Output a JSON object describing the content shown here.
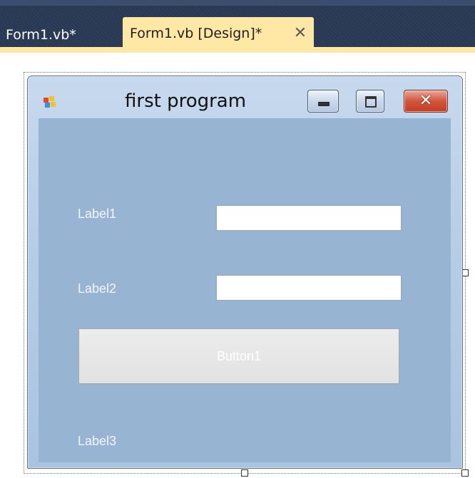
{
  "tabs": {
    "inactive_label": "Form1.vb*",
    "active_label": "Form1.vb [Design]*",
    "close_glyph": "✕"
  },
  "form": {
    "title": "first program",
    "title_icon": "winforms-app-icon",
    "close_glyph": "✕"
  },
  "controls": {
    "label1": "Label1",
    "label2": "Label2",
    "label3": "Label3",
    "textbox1_value": "",
    "textbox2_value": "",
    "button1": "Button1"
  },
  "colors": {
    "tab_strip": "#293955",
    "active_tab": "#ffe8a6",
    "form_client": "#98b4d3",
    "close_button": "#c43d22"
  }
}
